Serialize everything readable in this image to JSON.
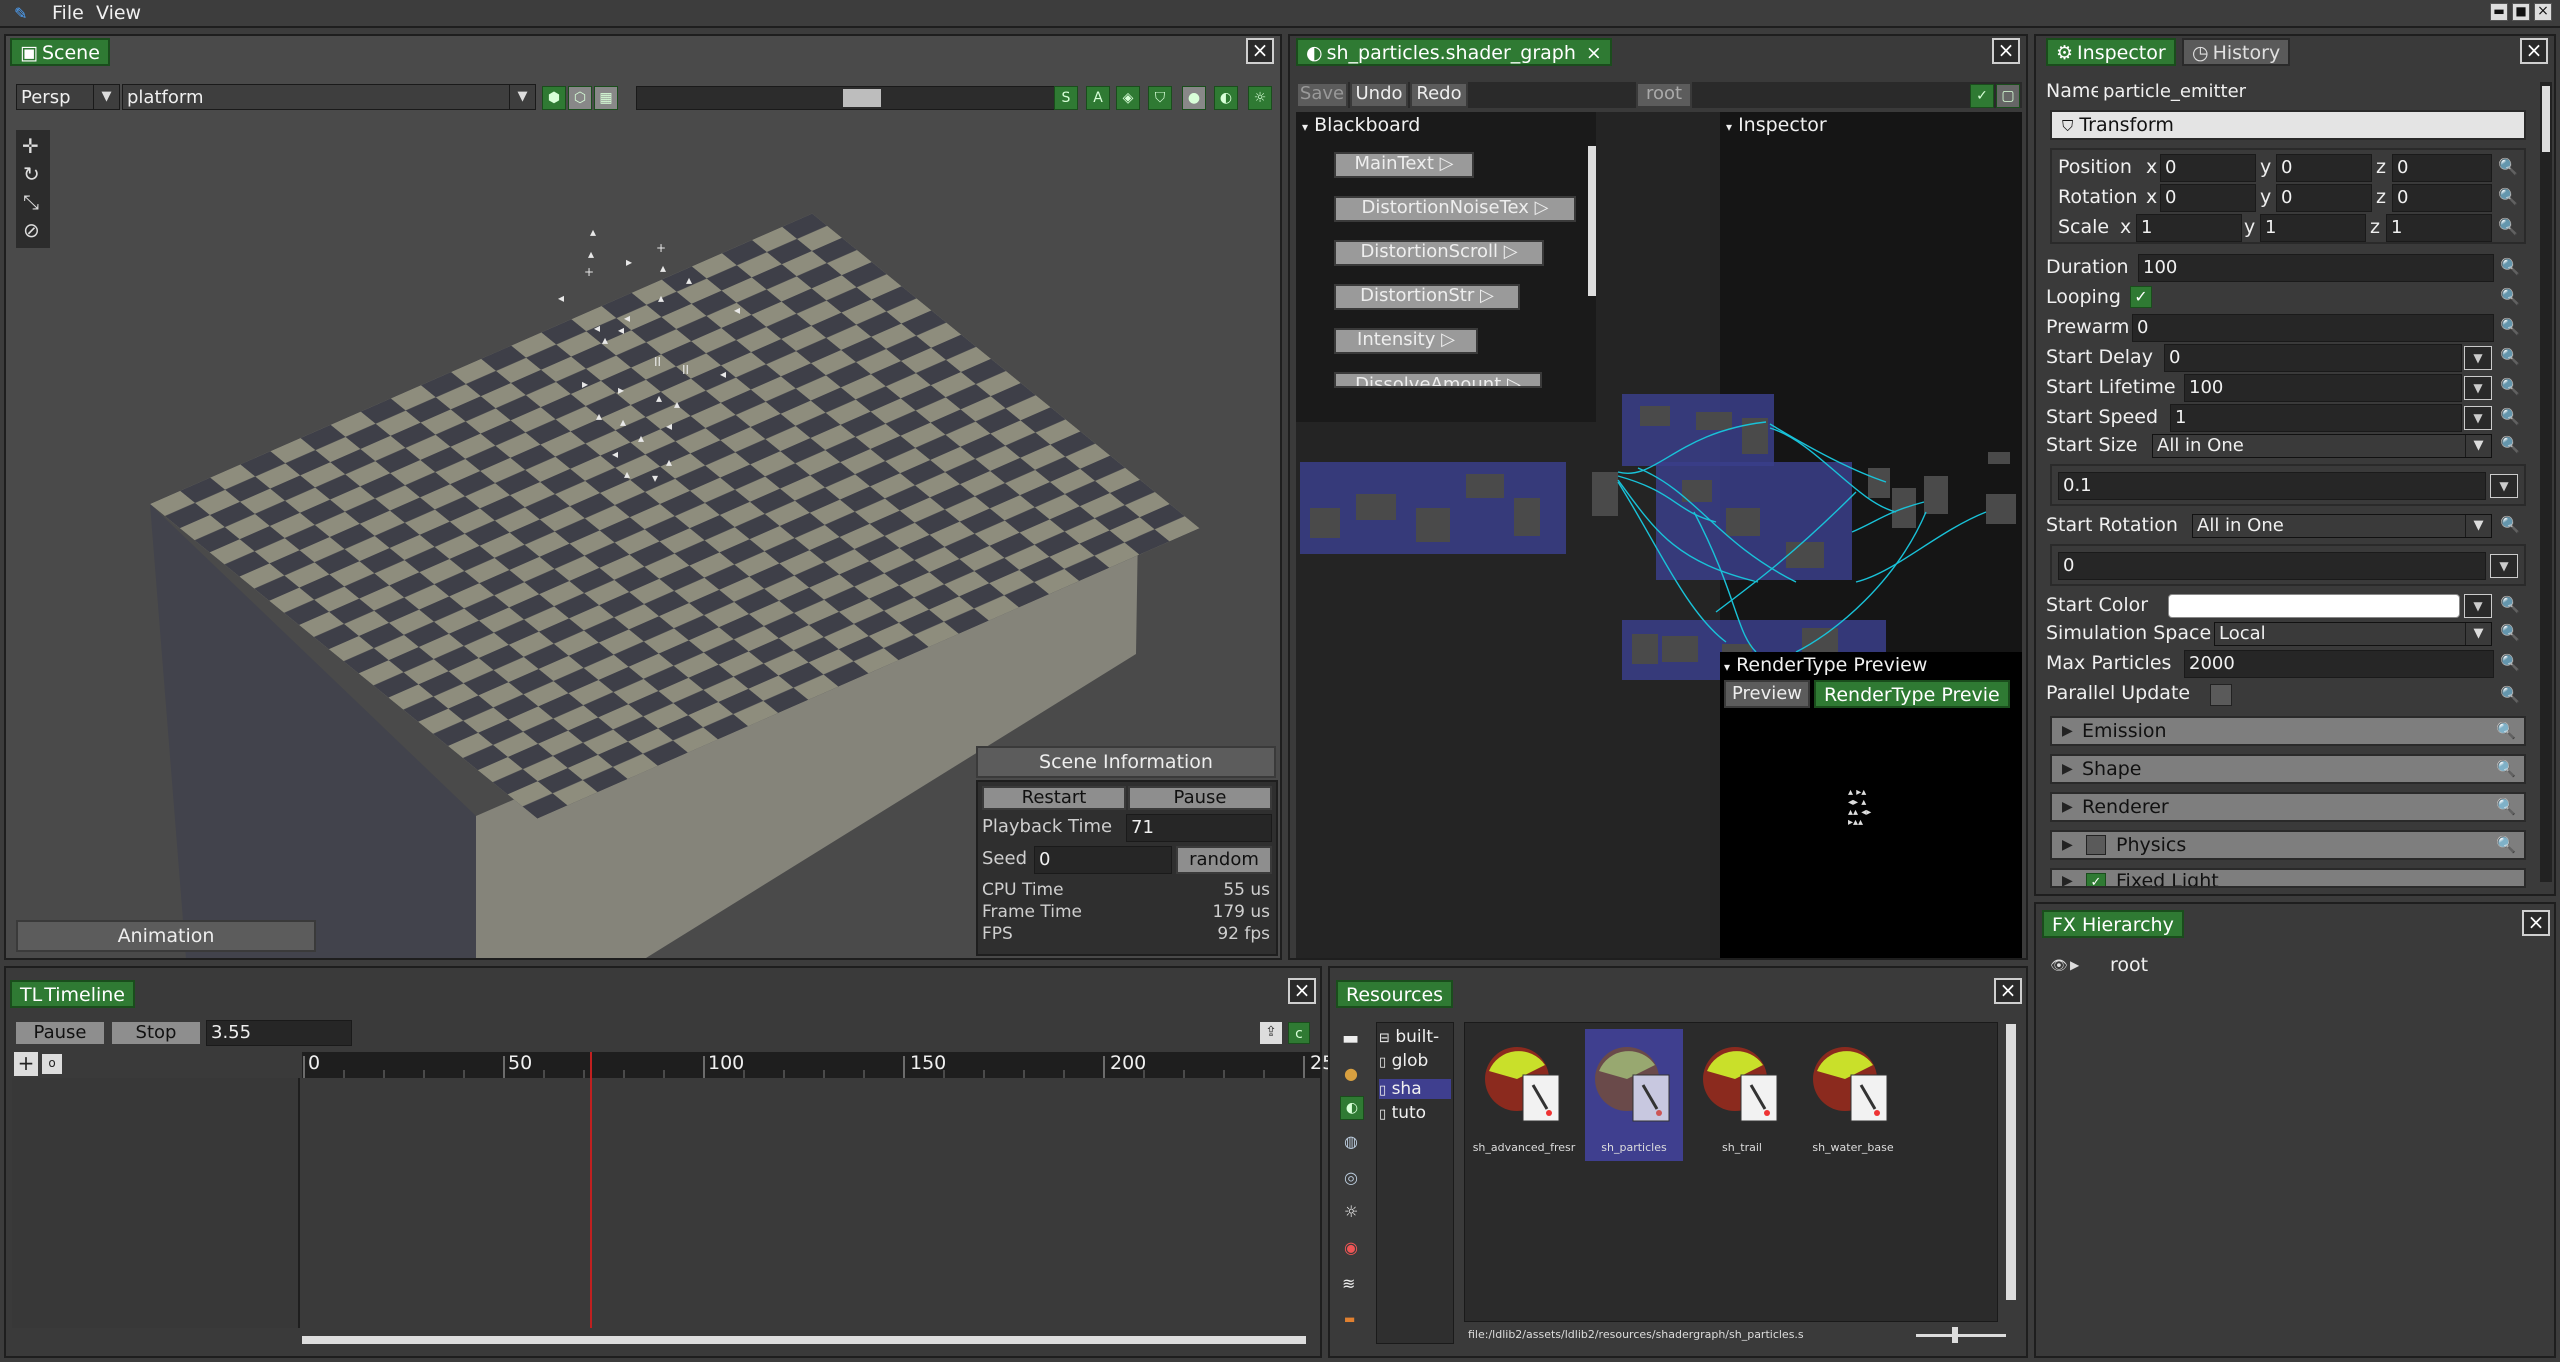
{
  "menubar": {
    "file": "File",
    "view": "View"
  },
  "scene": {
    "tab": "Scene",
    "camera_mode": "Persp",
    "scene_select": "platform",
    "info_button": "Scene Information",
    "restart": "Restart",
    "pause": "Pause",
    "playback_label": "Playback Time",
    "playback_value": "71",
    "seed_label": "Seed",
    "seed_value": "0",
    "random": "random",
    "cpu_label": "CPU Time",
    "cpu_value": "55 us",
    "frame_label": "Frame Time",
    "frame_value": "179 us",
    "fps_label": "FPS",
    "fps_value": "92 fps",
    "animation_button": "Animation"
  },
  "shader": {
    "tab": "sh_particles.shader_graph",
    "save": "Save",
    "undo": "Undo",
    "redo": "Redo",
    "root": "root",
    "blackboard": "Blackboard",
    "bb_items": [
      "MainText",
      "DistortionNoiseTex",
      "DistortionScroll",
      "DistortionStr",
      "Intensity",
      "DissolveAmount"
    ],
    "inspector": "Inspector",
    "preview_title": "RenderType Preview",
    "preview_btn": "Preview",
    "preview_tab": "RenderType Previe"
  },
  "inspector": {
    "tab": "Inspector",
    "history_tab": "History",
    "name_label": "Name",
    "name_value": "particle_emitter",
    "transform": "Transform",
    "position": "Position",
    "rotation": "Rotation",
    "scale": "Scale",
    "x": "x",
    "y": "y",
    "z": "z",
    "pos": [
      "0",
      "0",
      "0"
    ],
    "rot": [
      "0",
      "0",
      "0"
    ],
    "scl": [
      "1",
      "1",
      "1"
    ],
    "duration_label": "Duration",
    "duration_value": "100",
    "looping_label": "Looping",
    "prewarm_label": "Prewarm",
    "prewarm_value": "0",
    "start_delay_label": "Start Delay",
    "start_delay_value": "0",
    "start_lifetime_label": "Start Lifetime",
    "start_lifetime_value": "100",
    "start_speed_label": "Start Speed",
    "start_speed_value": "1",
    "start_size_label": "Start Size",
    "start_size_mode": "All in One",
    "start_size_value": "0.1",
    "start_rotation_label": "Start Rotation",
    "start_rotation_mode": "All in One",
    "start_rotation_value": "0",
    "start_color_label": "Start Color",
    "sim_space_label": "Simulation Space",
    "sim_space_value": "Local",
    "max_particles_label": "Max Particles",
    "max_particles_value": "2000",
    "parallel_label": "Parallel Update",
    "sections": [
      "Emission",
      "Shape",
      "Renderer",
      "Physics",
      "Fixed Light"
    ]
  },
  "fx": {
    "tab": "FX Hierarchy",
    "root": "root"
  },
  "timeline": {
    "tab": "Timeline",
    "tab_icon": "TL",
    "pause": "Pause",
    "stop": "Stop",
    "time": "3.55",
    "ticks": [
      "0",
      "50",
      "100",
      "150",
      "200",
      "25"
    ]
  },
  "resources": {
    "tab": "Resources",
    "tree": [
      "built-",
      "glob",
      "sha",
      "tuto"
    ],
    "items": [
      "sh_advanced_fresr",
      "sh_particles",
      "sh_trail",
      "sh_water_base"
    ],
    "path": "file:/ldlib2/assets/ldlib2/resources/shadergraph/sh_particles.s"
  },
  "colors": {
    "accent": "#2f7a33",
    "selected": "#3f3f8f",
    "blackboard_btn": "#9a9a9a"
  }
}
